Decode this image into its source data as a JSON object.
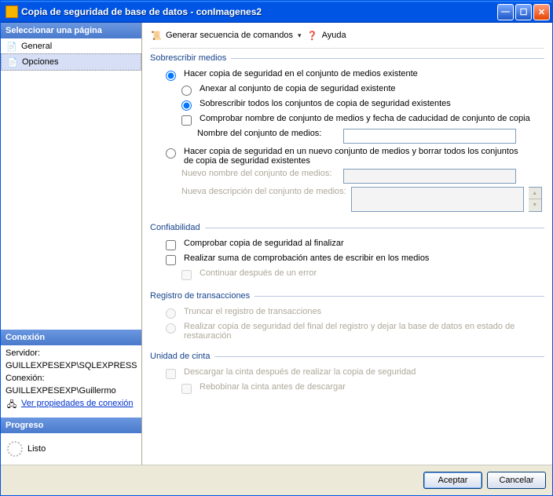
{
  "window": {
    "title": "Copia de seguridad de base de datos - conImagenes2"
  },
  "sidebar": {
    "header": "Seleccionar una página",
    "items": [
      "General",
      "Opciones"
    ],
    "selected_index": 1,
    "connection": {
      "header": "Conexión",
      "server_label": "Servidor:",
      "server_value": "GUILLEXPESEXP\\SQLEXPRESS",
      "conn_label": "Conexión:",
      "conn_value": "GUILLEXPESEXP\\Guillermo",
      "props_link": "Ver propiedades de conexión"
    },
    "progress": {
      "header": "Progreso",
      "state": "Listo"
    }
  },
  "toolbar": {
    "script": "Generar secuencia de comandos",
    "help": "Ayuda"
  },
  "groups": {
    "overwrite": {
      "title": "Sobrescribir medios",
      "opt_existing": "Hacer copia de seguridad en el conjunto de medios existente",
      "opt_append": "Anexar al conjunto de copia de seguridad existente",
      "opt_overwrite_all": "Sobrescribir todos los conjuntos de copia de seguridad existentes",
      "chk_check": "Comprobar nombre de conjunto de medios y fecha de caducidad de conjunto de copia",
      "lbl_name": "Nombre del conjunto de medios:",
      "opt_new": "Hacer copia de seguridad en un nuevo conjunto de medios y borrar todos los conjuntos de copia de seguridad existentes",
      "lbl_new_name": "Nuevo nombre del conjunto de medios:",
      "lbl_new_desc": "Nueva descripción del conjunto de medios:"
    },
    "reliability": {
      "title": "Confiabilidad",
      "chk_verify": "Comprobar copia de seguridad al finalizar",
      "chk_checksum": "Realizar suma de comprobación antes de escribir en los medios",
      "chk_continue": "Continuar después de un error"
    },
    "tlog": {
      "title": "Registro de transacciones",
      "opt_truncate": "Truncar el registro de transacciones",
      "opt_tail": "Realizar copia de seguridad del final del registro y dejar la base de datos en estado de restauración"
    },
    "tape": {
      "title": "Unidad de cinta",
      "chk_unload": "Descargar la cinta después de realizar la copia de seguridad",
      "chk_rewind": "Rebobinar la cinta antes de descargar"
    }
  },
  "buttons": {
    "ok": "Aceptar",
    "cancel": "Cancelar"
  }
}
